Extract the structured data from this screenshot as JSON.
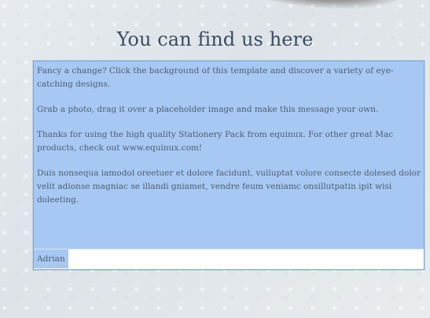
{
  "header": {
    "title": "You can find us here"
  },
  "message": {
    "paragraphs": [
      "Fancy a change? Click the background of this template and discover a variety of eye-catching designs.",
      "Grab a photo, drag it over a placeholder image and make this message your own.",
      "Thanks for using the high quality Stationery Pack from equinux. For other great Mac products, check out www.equinux.com!",
      "Duis nonsequa iamodol oreetuer et dolore facidunt, vulluptat volore consecte dolesed dolor velit adionse magniac se illandi gniamet, vendre feum veniamc onsillutpatin ipit wisi doleeting."
    ],
    "signature": "Adrian"
  },
  "colors": {
    "background": "#e6ebef",
    "title": "#3a4c60",
    "body_text": "#4d5d74",
    "selection": "#a7c8f2",
    "border": "#7ea6d8"
  }
}
